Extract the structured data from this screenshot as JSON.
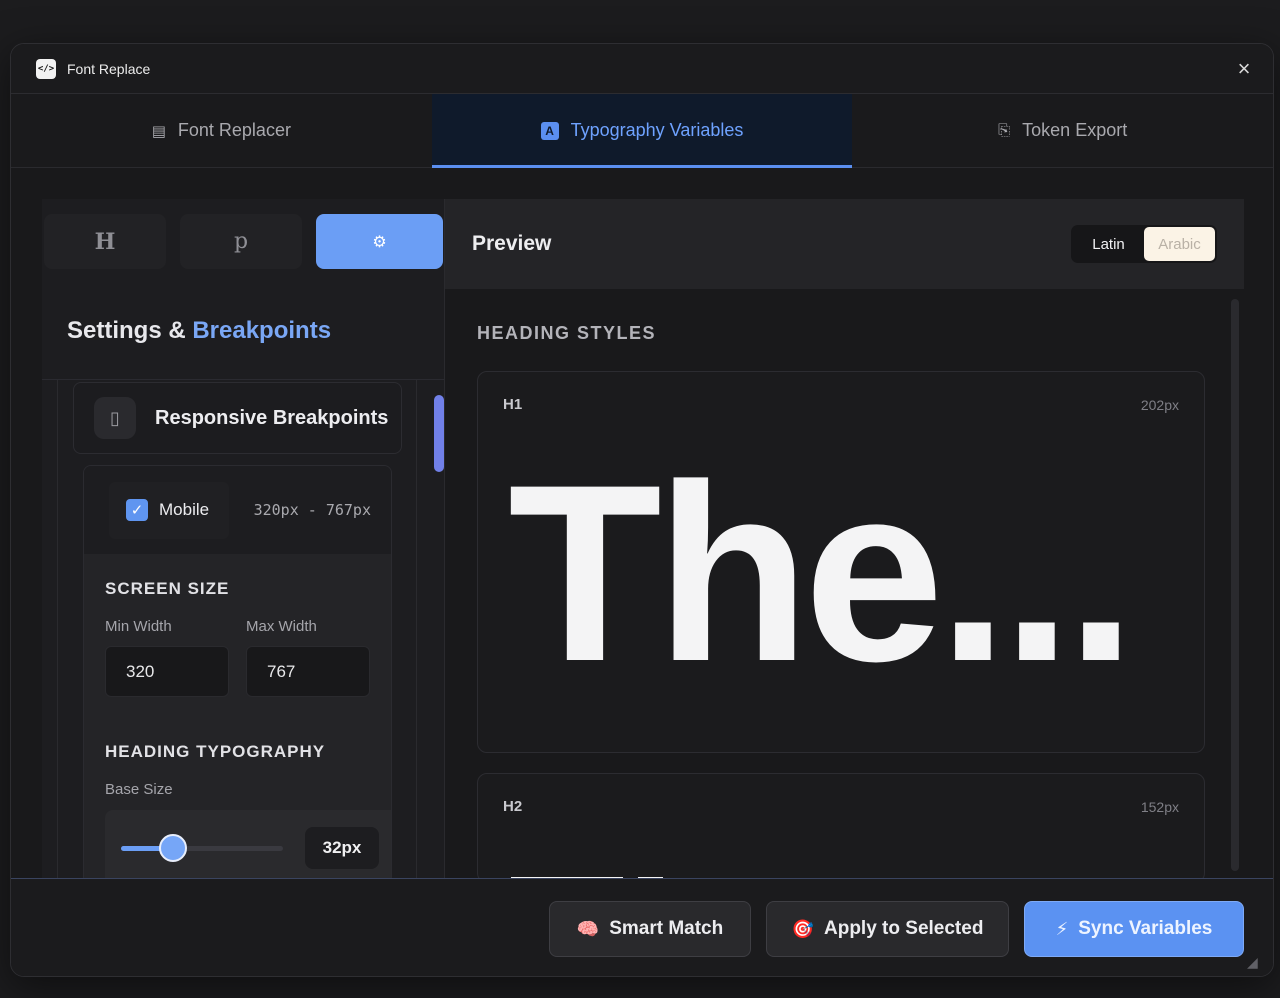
{
  "window": {
    "title": "Font Replace",
    "app_icon": "code-icon",
    "close_icon": "close-icon"
  },
  "tabs": [
    {
      "label": "Font Replacer",
      "icon": "list-icon",
      "active": false
    },
    {
      "label": "Typography Variables",
      "icon": "typography-icon",
      "active": true
    },
    {
      "label": "Token Export",
      "icon": "export-file-icon",
      "active": false
    }
  ],
  "left_panel": {
    "segments": [
      {
        "label": "H",
        "name": "heading"
      },
      {
        "label": "p",
        "name": "paragraph"
      },
      {
        "label": "⚙",
        "name": "settings",
        "active": true
      }
    ],
    "title_part1": "Settings & ",
    "title_part2": "Breakpoints",
    "breakpoints_card": {
      "icon": "mobile-phone-icon",
      "title": "Responsive Breakpoints"
    },
    "mobile": {
      "checked": true,
      "label": "Mobile",
      "range": "320px - 767px",
      "screen_size_label": "SCREEN SIZE",
      "min_width_label": "Min Width",
      "max_width_label": "Max Width",
      "min_width_value": "320",
      "max_width_value": "767",
      "heading_typography_label": "HEADING TYPOGRAPHY",
      "base_size_label": "Base Size",
      "base_size_value": "32px",
      "base_size_fraction": 0.32
    }
  },
  "preview": {
    "title": "Preview",
    "lang_options": [
      "Latin",
      "Arabic"
    ],
    "selected_lang": "Latin",
    "section_label": "HEADING STYLES",
    "styles": [
      {
        "tag": "H1",
        "size": "202px",
        "sample": "The..."
      },
      {
        "tag": "H2",
        "size": "152px",
        "sample": ""
      }
    ]
  },
  "footer": {
    "smart_match": {
      "label": "Smart Match",
      "icon": "brain-icon"
    },
    "apply_selected": {
      "label": "Apply to Selected",
      "icon": "target-icon"
    },
    "sync_variables": {
      "label": "Sync Variables",
      "icon": "lightning-icon"
    }
  },
  "colors": {
    "accent": "#5b92f2",
    "background": "#19191b"
  }
}
